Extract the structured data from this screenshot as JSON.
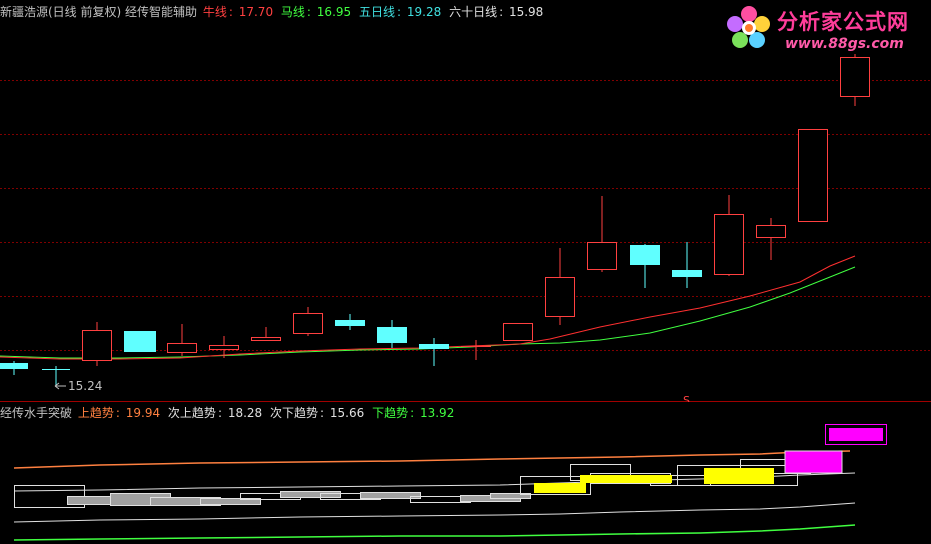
{
  "top_legend": {
    "title": "新疆浩源(日线 前复权) 经传智能辅助",
    "items": [
      {
        "label": "牛线",
        "sep": ":",
        "value": "17.70",
        "color": "#ff4040"
      },
      {
        "label": "马线",
        "sep": ":",
        "value": "16.95",
        "color": "#40ff40"
      },
      {
        "label": "五日线",
        "sep": ":",
        "value": "19.28",
        "color": "#40e0e0"
      },
      {
        "label": "六十日线",
        "sep": ":",
        "value": "15.98",
        "color": "#e0e0e0"
      }
    ]
  },
  "low_marker": "15.24",
  "s_marker": "S",
  "bottom_legend": {
    "title": "经传水手突破",
    "items": [
      {
        "label": "上趋势",
        "sep": ":",
        "value": "19.94",
        "color": "#ff8040"
      },
      {
        "label": "次上趋势",
        "sep": ":",
        "value": "18.28",
        "color": "#e0e0e0"
      },
      {
        "label": "次下趋势",
        "sep": ":",
        "value": "15.66",
        "color": "#e0e0e0"
      },
      {
        "label": "下趋势",
        "sep": ":",
        "value": "13.92",
        "color": "#40ff40"
      }
    ]
  },
  "logo": {
    "brand": "分析家公式网",
    "url": "www.88gs.com"
  },
  "colors": {
    "up": "#ff4040",
    "down": "#60ffff",
    "grid": "#800000",
    "niu_line": "#ff3030",
    "ma_line": "#40ff40",
    "sub_up": "#ffff00",
    "sub_magenta": "#ff00ff",
    "sub_gray": "#a0a0a0"
  }
}
